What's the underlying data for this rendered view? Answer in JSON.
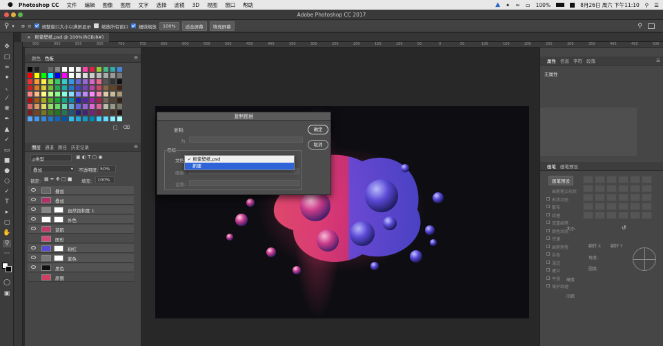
{
  "menubar": {
    "apple": "",
    "app": "Photoshop CC",
    "items": [
      "文件",
      "编辑",
      "图像",
      "图层",
      "文字",
      "选择",
      "滤镜",
      "3D",
      "视图",
      "窗口",
      "帮助"
    ],
    "battery": "100%",
    "datetime": "8月26日 周六 下午11:10"
  },
  "window": {
    "title": "Adobe Photoshop CC 2017"
  },
  "options": {
    "resize_label": "调整窗口大小以满屏显示",
    "zoom_all_label": "缩放所有窗口",
    "scrubby_label": "细微缩放",
    "zoom_value": "100%",
    "fit_label": "适合屏幕",
    "fill_label": "填充屏幕"
  },
  "document": {
    "tab": "粉紫壁纸.psd @ 100%(RGB/8#)"
  },
  "ruler_marks": [
    "950",
    "900",
    "850",
    "800",
    "750",
    "700",
    "650",
    "600",
    "550",
    "500",
    "450",
    "400",
    "350",
    "300",
    "250",
    "200",
    "150",
    "100",
    "50",
    "0",
    "50",
    "100",
    "150",
    "200",
    "250",
    "300",
    "350",
    "400",
    "450",
    "500"
  ],
  "swatches_panel": {
    "tabs": [
      "颜色",
      "色板"
    ]
  },
  "layers_panel": {
    "tabs": [
      "图层",
      "通道",
      "路径",
      "历史记录"
    ],
    "filter_label": "ρ类型",
    "blend_mode": "叠加",
    "opacity_label": "不透明度:",
    "opacity_value": "50%",
    "lock_label": "锁定:",
    "fill_label": "填充:",
    "fill_value": "100%",
    "layers": [
      {
        "name": "叠加",
        "visible": true
      },
      {
        "name": "叠加",
        "visible": true
      },
      {
        "name": "自然饱和度 1",
        "visible": true
      },
      {
        "name": "补色",
        "visible": true
      },
      {
        "name": "蓝肌",
        "visible": true
      },
      {
        "name": "图形",
        "visible": false
      },
      {
        "name": "粉红",
        "visible": true
      },
      {
        "name": "紫色",
        "visible": true
      },
      {
        "name": "黑色",
        "visible": true
      },
      {
        "name": "原图",
        "visible": false
      }
    ]
  },
  "properties_panel": {
    "tabs": [
      "属性",
      "信息",
      "字符",
      "段落"
    ],
    "no_properties": "无属性"
  },
  "brush_panel": {
    "tabs": [
      "画笔",
      "画笔预设"
    ],
    "preset_button": "画笔预设",
    "options": [
      "画笔笔尖形状",
      "形状动态",
      "散布",
      "纹理",
      "双重画笔",
      "颜色动态",
      "传递",
      "画笔笔势",
      "杂色",
      "湿边",
      "建立",
      "平滑",
      "保护纹理"
    ],
    "size_label": "大小",
    "flip_x": "翻转 X",
    "flip_y": "翻转 Y",
    "angle_label": "角度:",
    "roundness_label": "圆度:",
    "hardness_label": "硬度",
    "spacing_label": "间距"
  },
  "dialog": {
    "title": "复制图层",
    "copy_label": "复制:",
    "as_label": "为:",
    "target_label": "目标",
    "doc_label": "文档:",
    "artboard_label": "画板:",
    "name_label": "名称:",
    "ok_button": "确定",
    "cancel_button": "取消",
    "dropdown_options": [
      {
        "label": "✓ 粉紫壁纸.psd",
        "selected": false
      },
      {
        "label": "新建",
        "selected": true
      }
    ]
  },
  "colors": {
    "accent": "#2f64d8",
    "panel": "#464646",
    "canvas_pink": "#e0366a",
    "canvas_purple": "#5a4ad8"
  }
}
